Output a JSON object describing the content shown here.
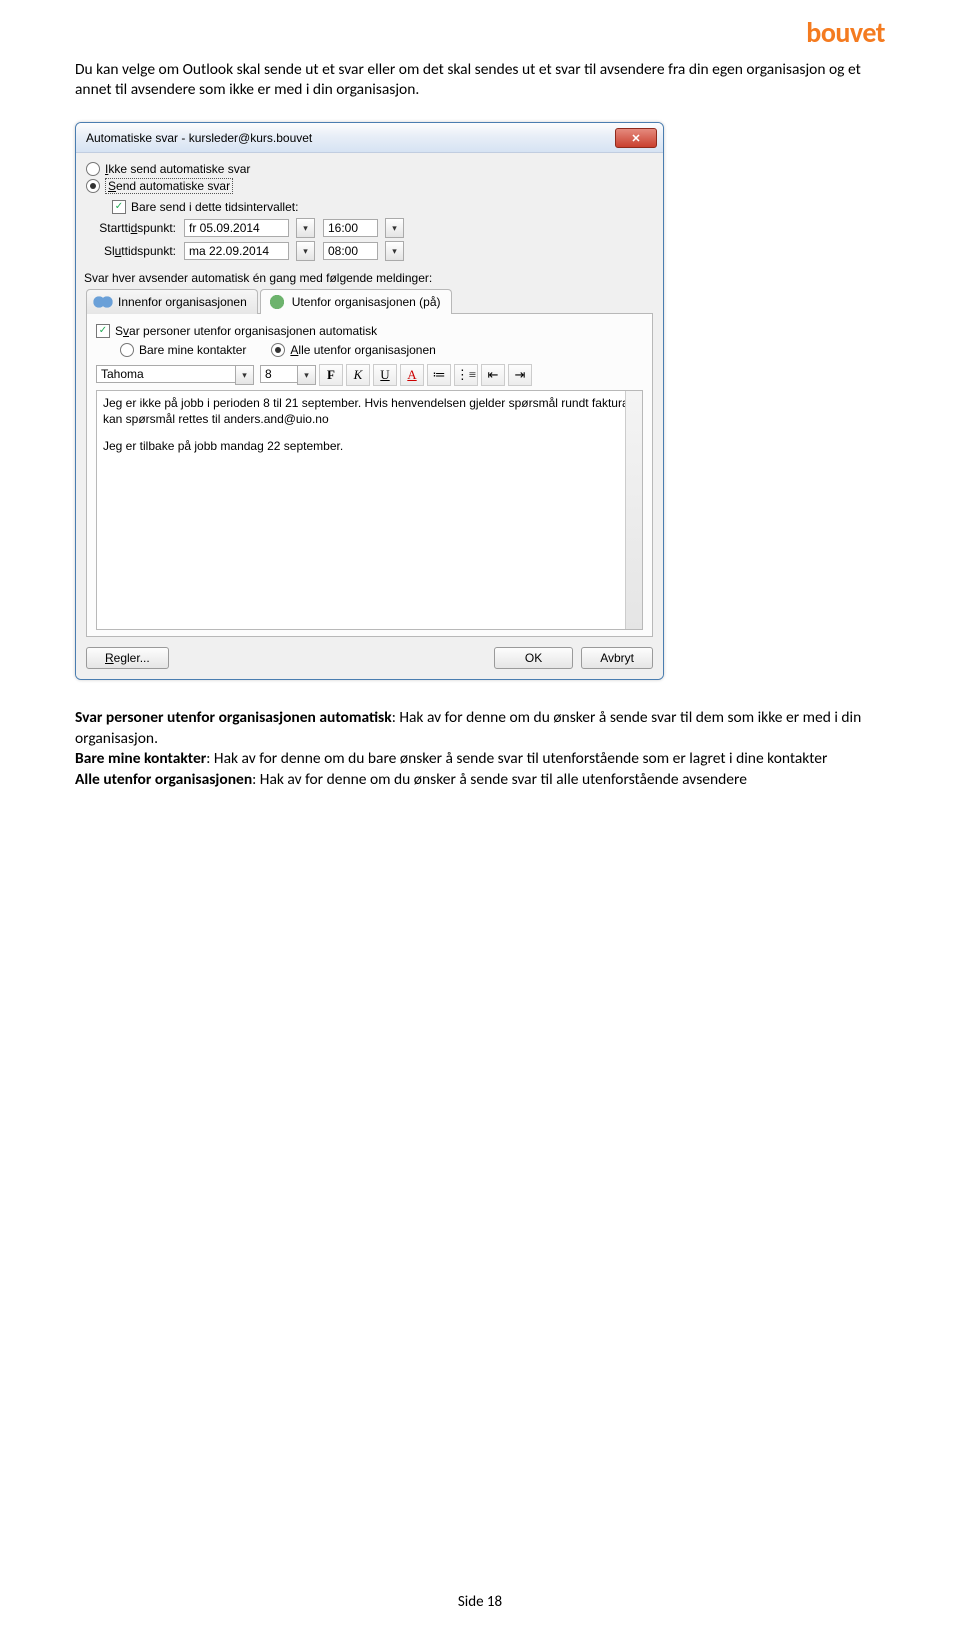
{
  "logo_text": "bouvet",
  "intro": "Du kan velge om Outlook skal sende ut et svar eller om det skal sendes ut et svar til avsendere fra din egen organisasjon og et annet til avsendere som ikke er med i din organisasjon.",
  "dialog": {
    "title": "Automatiske svar - kursleder@kurs.bouvet",
    "opt_no_send": "Ikke send automatiske svar",
    "opt_send": "Send automatiske svar",
    "chk_only_interval": "Bare send i dette tidsintervallet:",
    "start_label": "Starttidspunkt:",
    "end_label": "Sluttidspunkt:",
    "start_date": "fr 05.09.2014",
    "start_time": "16:00",
    "end_date": "ma 22.09.2014",
    "end_time": "08:00",
    "reply_label": "Svar hver avsender automatisk én gang med følgende meldinger:",
    "tab_inside": "Innenfor organisasjonen",
    "tab_outside": "Utenfor organisasjonen (på)",
    "chk_outside_auto": "Svar personer utenfor organisasjonen automatisk",
    "radio_my_contacts": "Bare mine kontakter",
    "radio_all_outside": "Alle utenfor organisasjonen",
    "font_name": "Tahoma",
    "font_size": "8",
    "message_l1": "Jeg er ikke på jobb i perioden 8 til 21 september. Hvis henvendelsen gjelder spørsmål rundt faktura kan spørsmål rettes til anders.and@uio.no",
    "message_l2": "Jeg er tilbake på jobb mandag 22 september.",
    "btn_rules": "Regler...",
    "btn_ok": "OK",
    "btn_cancel": "Avbryt"
  },
  "after": {
    "p1_b": "Svar personer utenfor organisasjonen automatisk",
    "p1_t": ": Hak av for denne om du ønsker å sende svar til dem som ikke er med i din organisasjon.",
    "p2_b": "Bare mine kontakter",
    "p2_t": ": Hak av for denne om du bare ønsker å sende svar til utenforstående som er lagret i dine kontakter",
    "p3_b": "Alle utenfor organisasjonen",
    "p3_t": ": Hak av for denne om du ønsker å sende svar til alle utenforstående avsendere"
  },
  "page_num": "Side 18"
}
